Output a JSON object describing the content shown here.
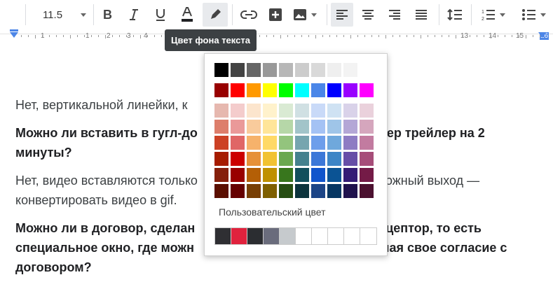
{
  "toolbar": {
    "font_size": "11.5",
    "color_bar": "#202124"
  },
  "ruler": {
    "numbers": [
      "1",
      "1",
      "2",
      "3",
      "4",
      "13",
      "14",
      "15",
      "16"
    ]
  },
  "tooltip": {
    "text": "Цвет фона текста"
  },
  "palette": {
    "grays": [
      "#000000",
      "#434343",
      "#666666",
      "#999999",
      "#b7b7b7",
      "#cccccc",
      "#d9d9d9",
      "#efefef",
      "#f3f3f3",
      "#ffffff"
    ],
    "brights": [
      "#980000",
      "#ff0000",
      "#ff9900",
      "#ffff00",
      "#00ff00",
      "#00ffff",
      "#4a86e8",
      "#0000ff",
      "#9900ff",
      "#ff00ff"
    ],
    "shades": [
      [
        "#e6b8af",
        "#f4cccc",
        "#fce5cd",
        "#fff2cc",
        "#d9ead3",
        "#d0e0e3",
        "#c9daf8",
        "#cfe2f3",
        "#d9d2e9",
        "#ead1dc"
      ],
      [
        "#dd7e6b",
        "#ea9999",
        "#f9cb9c",
        "#ffe599",
        "#b6d7a8",
        "#a2c4c9",
        "#a4c2f4",
        "#9fc5e8",
        "#b4a7d6",
        "#d5a6bd"
      ],
      [
        "#cc4125",
        "#e06666",
        "#f6b26b",
        "#ffd966",
        "#93c47d",
        "#76a5af",
        "#6d9eeb",
        "#6fa8dc",
        "#8e7cc3",
        "#c27ba0"
      ],
      [
        "#a61c00",
        "#cc0000",
        "#e69138",
        "#f1c232",
        "#6aa84f",
        "#45818e",
        "#3c78d8",
        "#3d85c6",
        "#674ea7",
        "#a64d79"
      ],
      [
        "#85200c",
        "#990000",
        "#b45f06",
        "#bf9000",
        "#38761d",
        "#134f5c",
        "#1155cc",
        "#0b5394",
        "#351c75",
        "#741b47"
      ],
      [
        "#5b0f00",
        "#660000",
        "#783f04",
        "#7f6000",
        "#274e13",
        "#0c343d",
        "#1c4587",
        "#073763",
        "#20124d",
        "#4c1130"
      ]
    ],
    "custom_label": "Пользовательский цвет",
    "custom_colors": [
      "#2f2f33",
      "#e0223d",
      "#2b2d31",
      "#6a6c7c",
      "#c6cacd",
      "#ffffff",
      "#ffffff",
      "#ffffff",
      "#ffffff",
      "#ffffff"
    ]
  },
  "document": {
    "p1": "Нет, вертикальной линейки, к",
    "q1_line1_a": "Можно ли вставить в гугл-до",
    "q1_line1_b": "ер трейлер на 2",
    "q1_line2": "минуты?",
    "a2_line1_a": "Нет, видео вставляются толькo",
    "a2_line1_b": "ожный выход —",
    "a2_line2": "конвертировать видео в gif.",
    "q3_line1_a": "Можно ли в договор, сделан",
    "q3_line1_b": "цептор, то есть",
    "q3_line2_a": "специальное окно, где можн",
    "q3_line2_b": "чая свое согласие с",
    "q3_line3": "договором?"
  }
}
